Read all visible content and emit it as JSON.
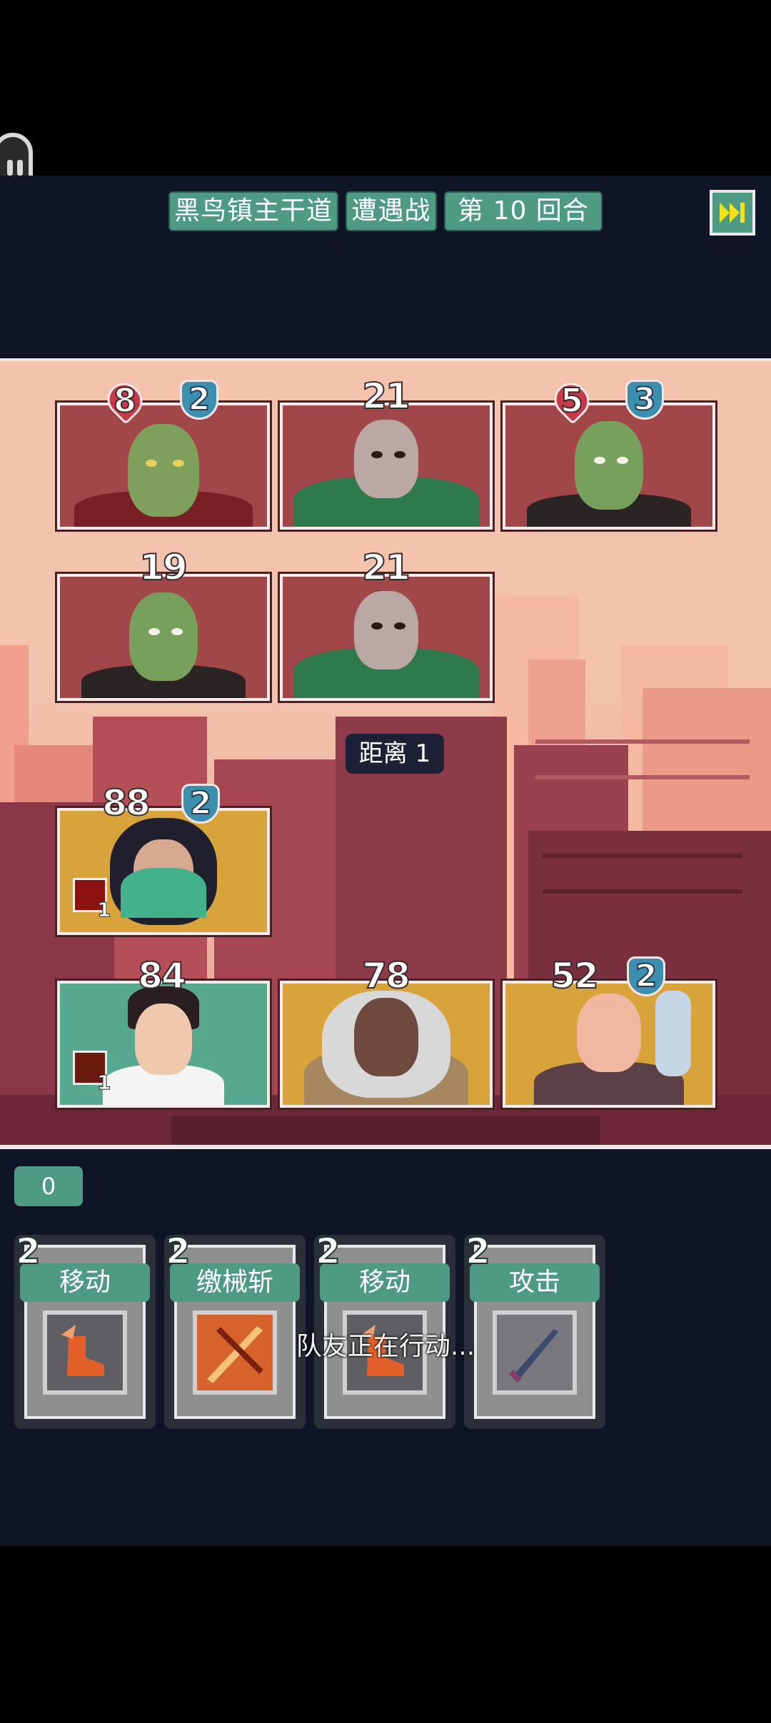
{
  "header": {
    "location": "黑鸟镇主干道",
    "battle_type": "遭遇战",
    "round": "第 10 回合"
  },
  "battlefield": {
    "distance": "距离 1",
    "enemies_row1": [
      {
        "name": "zombie-male",
        "hp": "8",
        "shield": "2"
      },
      {
        "name": "skeleton-zombie",
        "hp": "21",
        "shield": null
      },
      {
        "name": "zombie-female",
        "hp": "5",
        "shield": "3"
      }
    ],
    "enemies_row2": [
      {
        "name": "zombie-female",
        "hp": "19",
        "shield": null
      },
      {
        "name": "skeleton-zombie",
        "hp": "21",
        "shield": null
      }
    ],
    "allies_row1": [
      {
        "name": "masked-girl",
        "hp": "88",
        "shield": "2",
        "buff_count": "1"
      }
    ],
    "allies_row2": [
      {
        "name": "young-man",
        "hp": "84",
        "shield": null,
        "buff_count": "1"
      },
      {
        "name": "old-soldier",
        "hp": "78",
        "shield": null
      },
      {
        "name": "bald-man",
        "hp": "52",
        "shield": "2"
      }
    ]
  },
  "panel": {
    "counter": "0",
    "status_text": "队友正在行动...",
    "skills": [
      {
        "cost": "2",
        "label": "移动",
        "icon": "move-boot-icon"
      },
      {
        "cost": "2",
        "label": "缴械斩",
        "icon": "disarm-slash-icon"
      },
      {
        "cost": "2",
        "label": "移动",
        "icon": "move-boot-icon"
      },
      {
        "cost": "2",
        "label": "攻击",
        "icon": "sword-icon"
      }
    ]
  },
  "colors": {
    "accent_green": "#4f9a83",
    "navy": "#0f1427",
    "heart_red": "#c8394a",
    "shield_blue": "#3d8fb0"
  }
}
